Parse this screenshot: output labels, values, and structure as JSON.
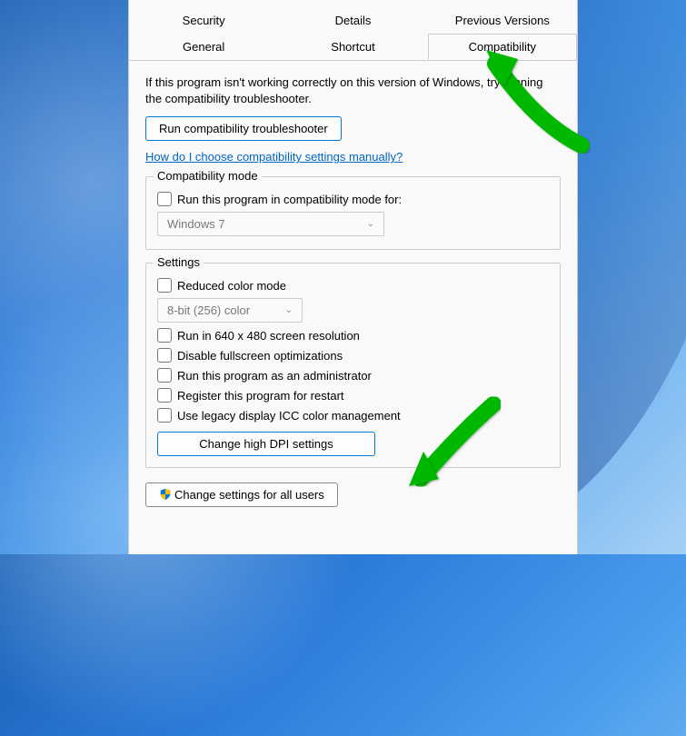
{
  "tabs": {
    "row1": [
      "Security",
      "Details",
      "Previous Versions"
    ],
    "row2": [
      "General",
      "Shortcut",
      "Compatibility"
    ],
    "active": "Compatibility"
  },
  "intro": "If this program isn't working correctly on this version of Windows, try running the compatibility troubleshooter.",
  "troubleshooter_btn": "Run compatibility troubleshooter",
  "help_link": "How do I choose compatibility settings manually?",
  "compat_mode": {
    "legend": "Compatibility mode",
    "checkbox": "Run this program in compatibility mode for:",
    "select_value": "Windows 7"
  },
  "settings": {
    "legend": "Settings",
    "reduced_color": "Reduced color mode",
    "color_select": "8-bit (256) color",
    "run_640": "Run in 640 x 480 screen resolution",
    "disable_fullscreen": "Disable fullscreen optimizations",
    "run_admin": "Run this program as an administrator",
    "register_restart": "Register this program for restart",
    "legacy_icc": "Use legacy display ICC color management",
    "dpi_btn": "Change high DPI settings"
  },
  "all_users_btn": "Change settings for all users",
  "annotations": {
    "arrow_color": "#00b800"
  }
}
